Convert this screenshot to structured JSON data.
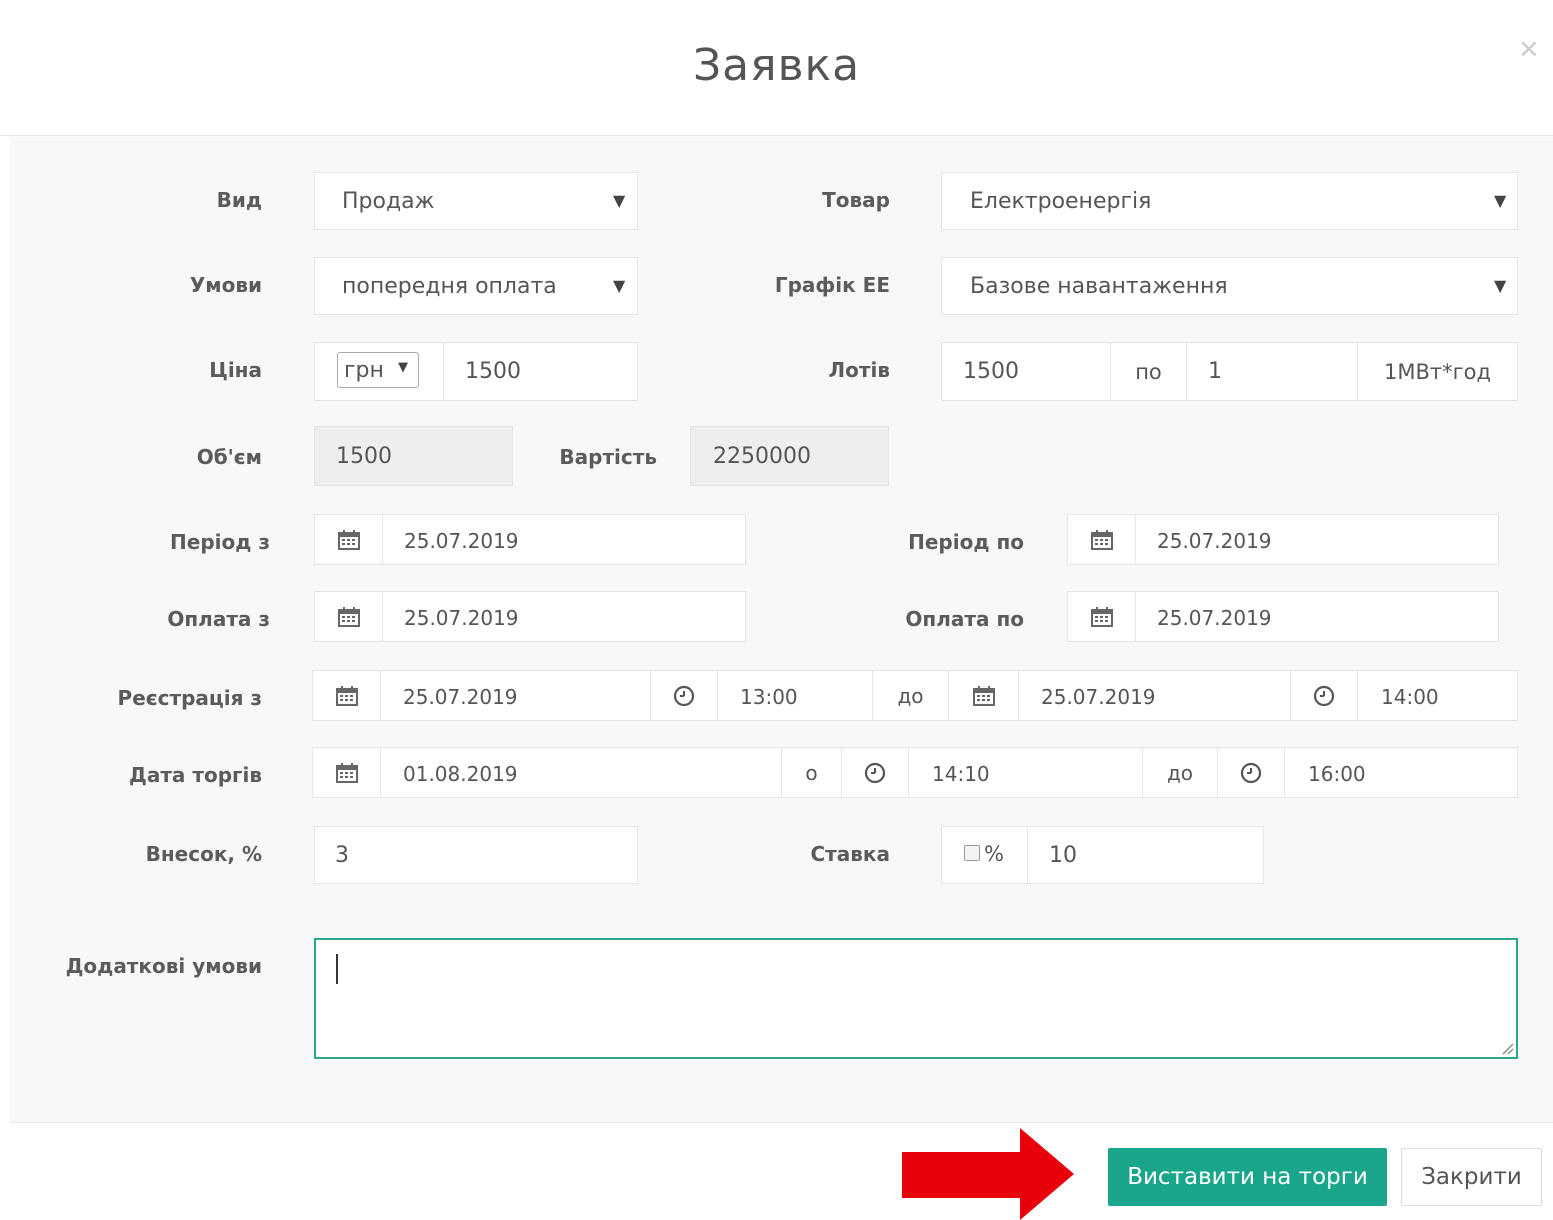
{
  "modal": {
    "title": "Заявка",
    "close_glyph": "×"
  },
  "form": {
    "vyd": {
      "label": "Вид",
      "value": "Продаж"
    },
    "tovar": {
      "label": "Товар",
      "value": "Електроенергія"
    },
    "umovy": {
      "label": "Умови",
      "value": "попередня оплата"
    },
    "grafik": {
      "label": "Графік ЕЕ",
      "value": "Базове навантаження"
    },
    "cina": {
      "label": "Ціна",
      "currency": "грн",
      "value": "1500"
    },
    "lotiv": {
      "label": "Лотів",
      "value": "1500",
      "separator": "по",
      "per_lot": "1",
      "unit": "1МВт*год"
    },
    "obiem": {
      "label": "Об'єм",
      "value": "1500"
    },
    "vartist": {
      "label": "Вартість",
      "value": "2250000"
    },
    "period_z": {
      "label": "Період з",
      "value": "25.07.2019"
    },
    "period_po": {
      "label": "Період по",
      "value": "25.07.2019"
    },
    "oplata_z": {
      "label": "Оплата з",
      "value": "25.07.2019"
    },
    "oplata_po": {
      "label": "Оплата по",
      "value": "25.07.2019"
    },
    "reestraciya": {
      "label": "Реєстрація з",
      "date_from": "25.07.2019",
      "time_from": "13:00",
      "separator": "до",
      "date_to": "25.07.2019",
      "time_to": "14:00"
    },
    "data_torgiv": {
      "label": "Дата торгів",
      "date": "01.08.2019",
      "separator_at": "о",
      "time_from": "14:10",
      "separator_to": "до",
      "time_to": "16:00"
    },
    "vnesok": {
      "label": "Внесок, %",
      "value": "3"
    },
    "stavka": {
      "label": "Ставка",
      "percent_label": "%",
      "value": "10"
    },
    "dodatkovi": {
      "label": "Додаткові умови",
      "value": ""
    }
  },
  "footer": {
    "submit_label": "Виставити на торги",
    "close_label": "Закрити"
  },
  "colors": {
    "primary": "#1aa68a",
    "arrow": "#e8000b"
  }
}
